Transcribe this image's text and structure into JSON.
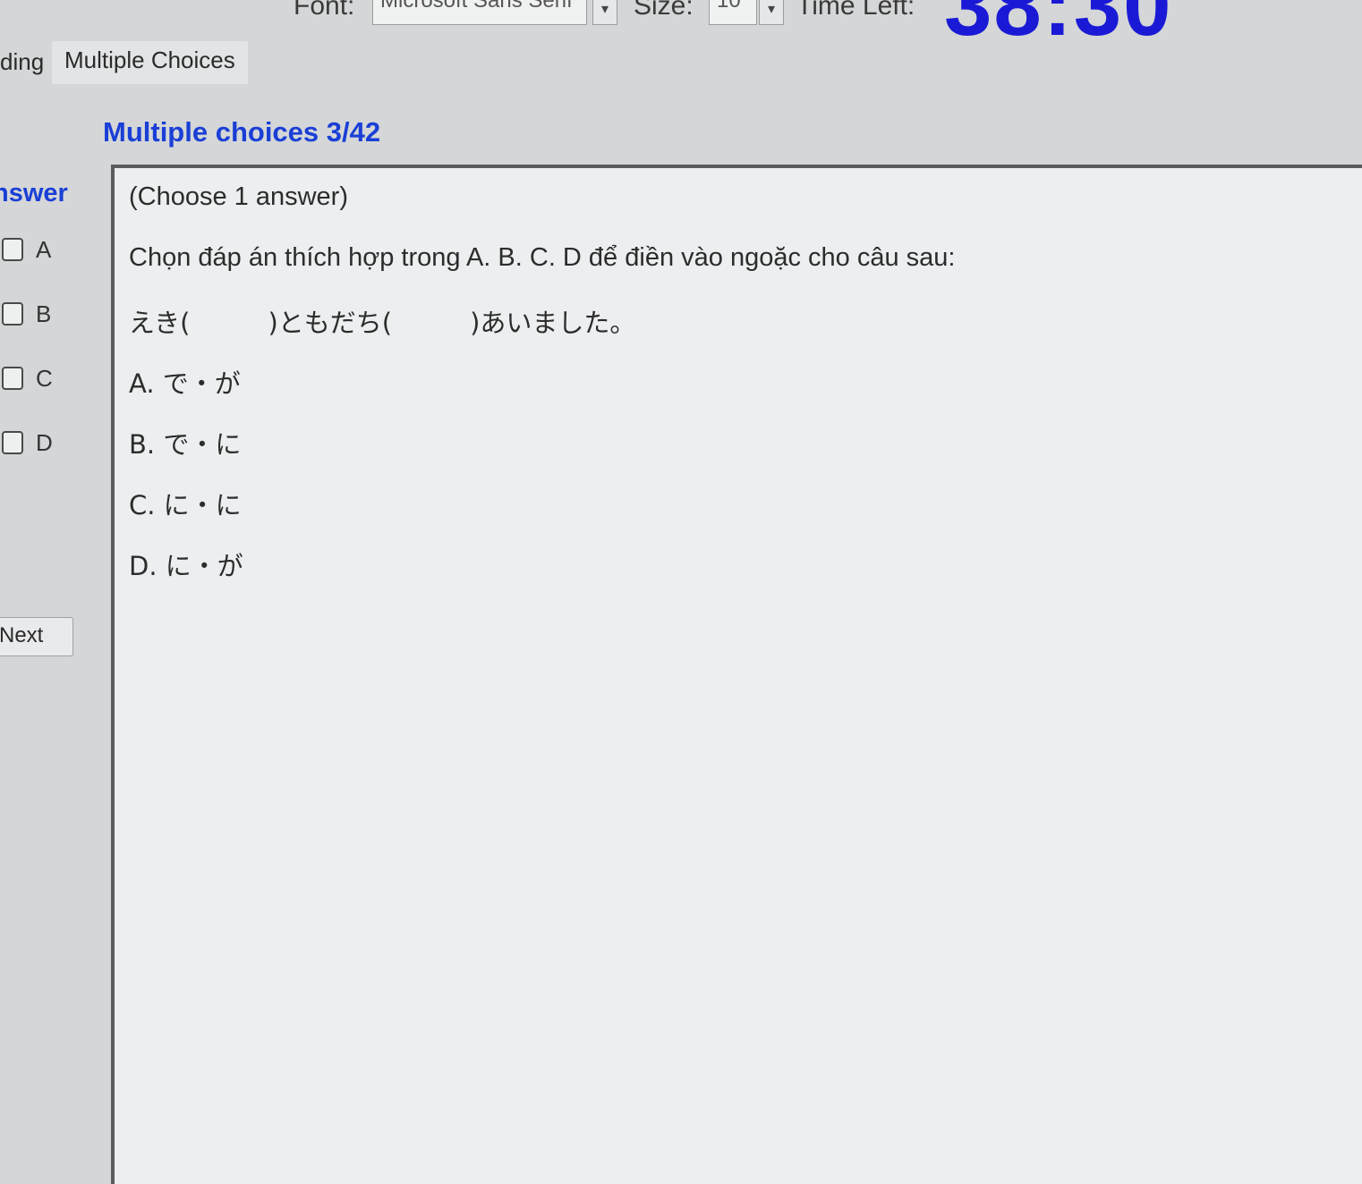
{
  "toolbar": {
    "font_label": "Font:",
    "font_value": "Microsoft Sans Serif",
    "size_label": "Size:",
    "size_value": "10",
    "time_left_label": "Time Left:",
    "timer_value": "38:30"
  },
  "tabs": [
    {
      "label": "ding"
    },
    {
      "label": "Multiple Choices"
    }
  ],
  "section_title": "Multiple choices 3/42",
  "answer_column": {
    "title": "nswer",
    "options": [
      "A",
      "B",
      "C",
      "D"
    ],
    "next_label": "Next"
  },
  "question": {
    "instruction": "(Choose 1 answer)",
    "prompt": "Chọn đáp án thích hợp trong A. B. C. D để điền vào ngoặc cho câu sau:",
    "sentence": "えき(　　　)ともだち(　　　)あいました。",
    "choices": [
      "A. で・が",
      "B. で・に",
      "C. に・に",
      "D. に・が"
    ]
  },
  "colors": {
    "timer": "#1a1ad6",
    "title_blue": "#1a3fd6",
    "background": "#d4d6d7",
    "panel": "#eceeef"
  }
}
